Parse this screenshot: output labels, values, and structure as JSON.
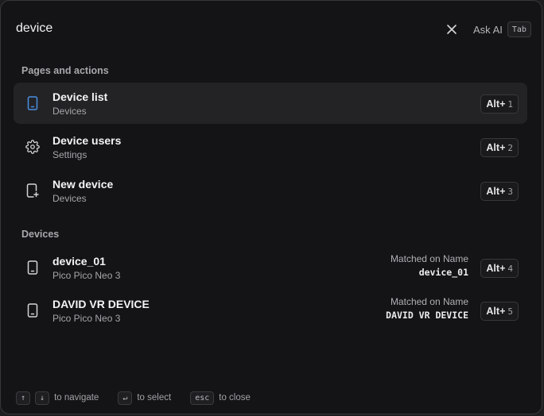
{
  "search": {
    "value": "device",
    "placeholder": ""
  },
  "header": {
    "ask_ai_label": "Ask AI",
    "ask_ai_key": "Tab"
  },
  "sections": [
    {
      "title": "Pages and actions",
      "items": [
        {
          "title": "Device list",
          "subtitle": "Devices",
          "icon": "tablet-icon",
          "shortcut_mod": "Alt+",
          "shortcut_key": "1",
          "active": true
        },
        {
          "title": "Device users",
          "subtitle": "Settings",
          "icon": "gear-icon",
          "shortcut_mod": "Alt+",
          "shortcut_key": "2"
        },
        {
          "title": "New device",
          "subtitle": "Devices",
          "icon": "add-device-icon",
          "shortcut_mod": "Alt+",
          "shortcut_key": "3"
        }
      ]
    },
    {
      "title": "Devices",
      "items": [
        {
          "title": "device_01",
          "subtitle": "Pico Pico Neo 3",
          "icon": "tablet-icon",
          "match_label": "Matched on Name",
          "match_value": "device_01",
          "shortcut_mod": "Alt+",
          "shortcut_key": "4"
        },
        {
          "title": "DAVID VR DEVICE",
          "subtitle": "Pico Pico Neo 3",
          "icon": "tablet-icon",
          "match_label": "Matched on Name",
          "match_value": "DAVID VR DEVICE",
          "shortcut_mod": "Alt+",
          "shortcut_key": "5"
        }
      ]
    }
  ],
  "footer": {
    "navigate_keys": [
      "↑",
      "↓"
    ],
    "navigate_label": "to navigate",
    "select_key": "↵",
    "select_label": "to select",
    "close_key": "esc",
    "close_label": "to close"
  },
  "colors": {
    "accent": "#4a90e2",
    "background": "#141416",
    "active_row": "#232326"
  }
}
